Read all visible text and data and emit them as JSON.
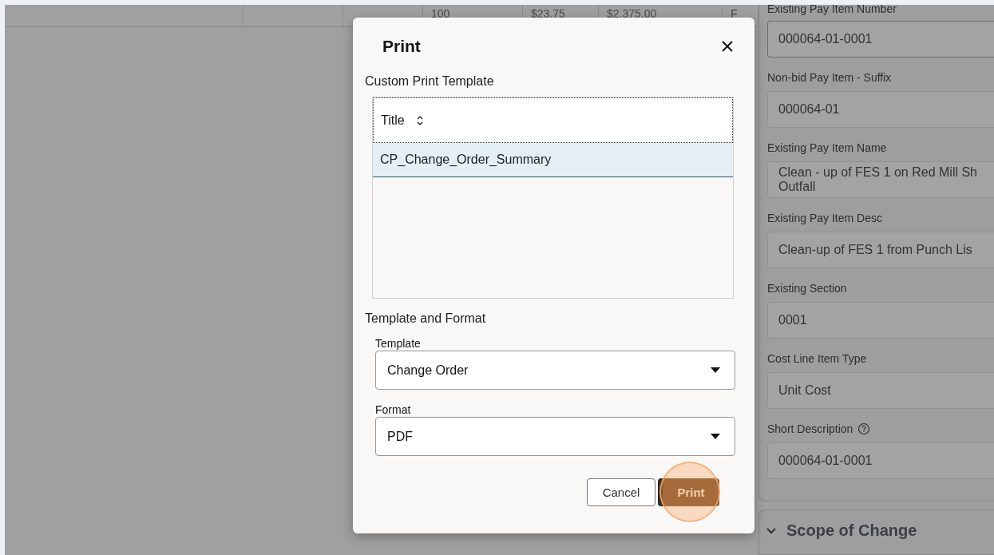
{
  "background_table": {
    "cells": [
      "",
      "",
      "",
      "100",
      "$23.75",
      "$2,375.00",
      "F"
    ]
  },
  "dialog": {
    "title": "Print",
    "section_title": "Custom Print Template",
    "table": {
      "column": "Title",
      "rows": [
        {
          "title": "CP_Change_Order_Summary",
          "selected": true
        }
      ]
    },
    "format_section": "Template and Format",
    "selects": [
      {
        "label": "Template",
        "value": "Change Order"
      },
      {
        "label": "Format",
        "value": "PDF"
      }
    ],
    "buttons": [
      {
        "label": "Cancel",
        "kind": "secondary"
      },
      {
        "label": "Print",
        "kind": "primary",
        "highlighted": true
      }
    ]
  },
  "side_panel": {
    "fields": [
      {
        "label": "Existing Pay Item Number",
        "lines": [
          "000064-01-0001"
        ],
        "help": false
      },
      {
        "label": "Non-bid Pay Item - Suffix",
        "lines": [
          "000064-01"
        ],
        "help": false
      },
      {
        "label": "Existing Pay Item Name",
        "lines": [
          "Clean - up of FES 1 on Red Mill Sh",
          "Outfall"
        ],
        "help": false
      },
      {
        "label": "Existing Pay Item Desc",
        "lines": [
          "Clean-up of FES 1 from Punch Lis"
        ],
        "help": false
      },
      {
        "label": "Existing Section",
        "lines": [
          "0001"
        ],
        "help": false
      },
      {
        "label": "Cost Line Item Type",
        "lines": [
          "Unit Cost"
        ],
        "help": false
      },
      {
        "label": "Short Description",
        "lines": [
          "000064-01-0001"
        ],
        "help": true
      }
    ],
    "section": {
      "title": "Scope of Change",
      "expanded": true
    }
  }
}
